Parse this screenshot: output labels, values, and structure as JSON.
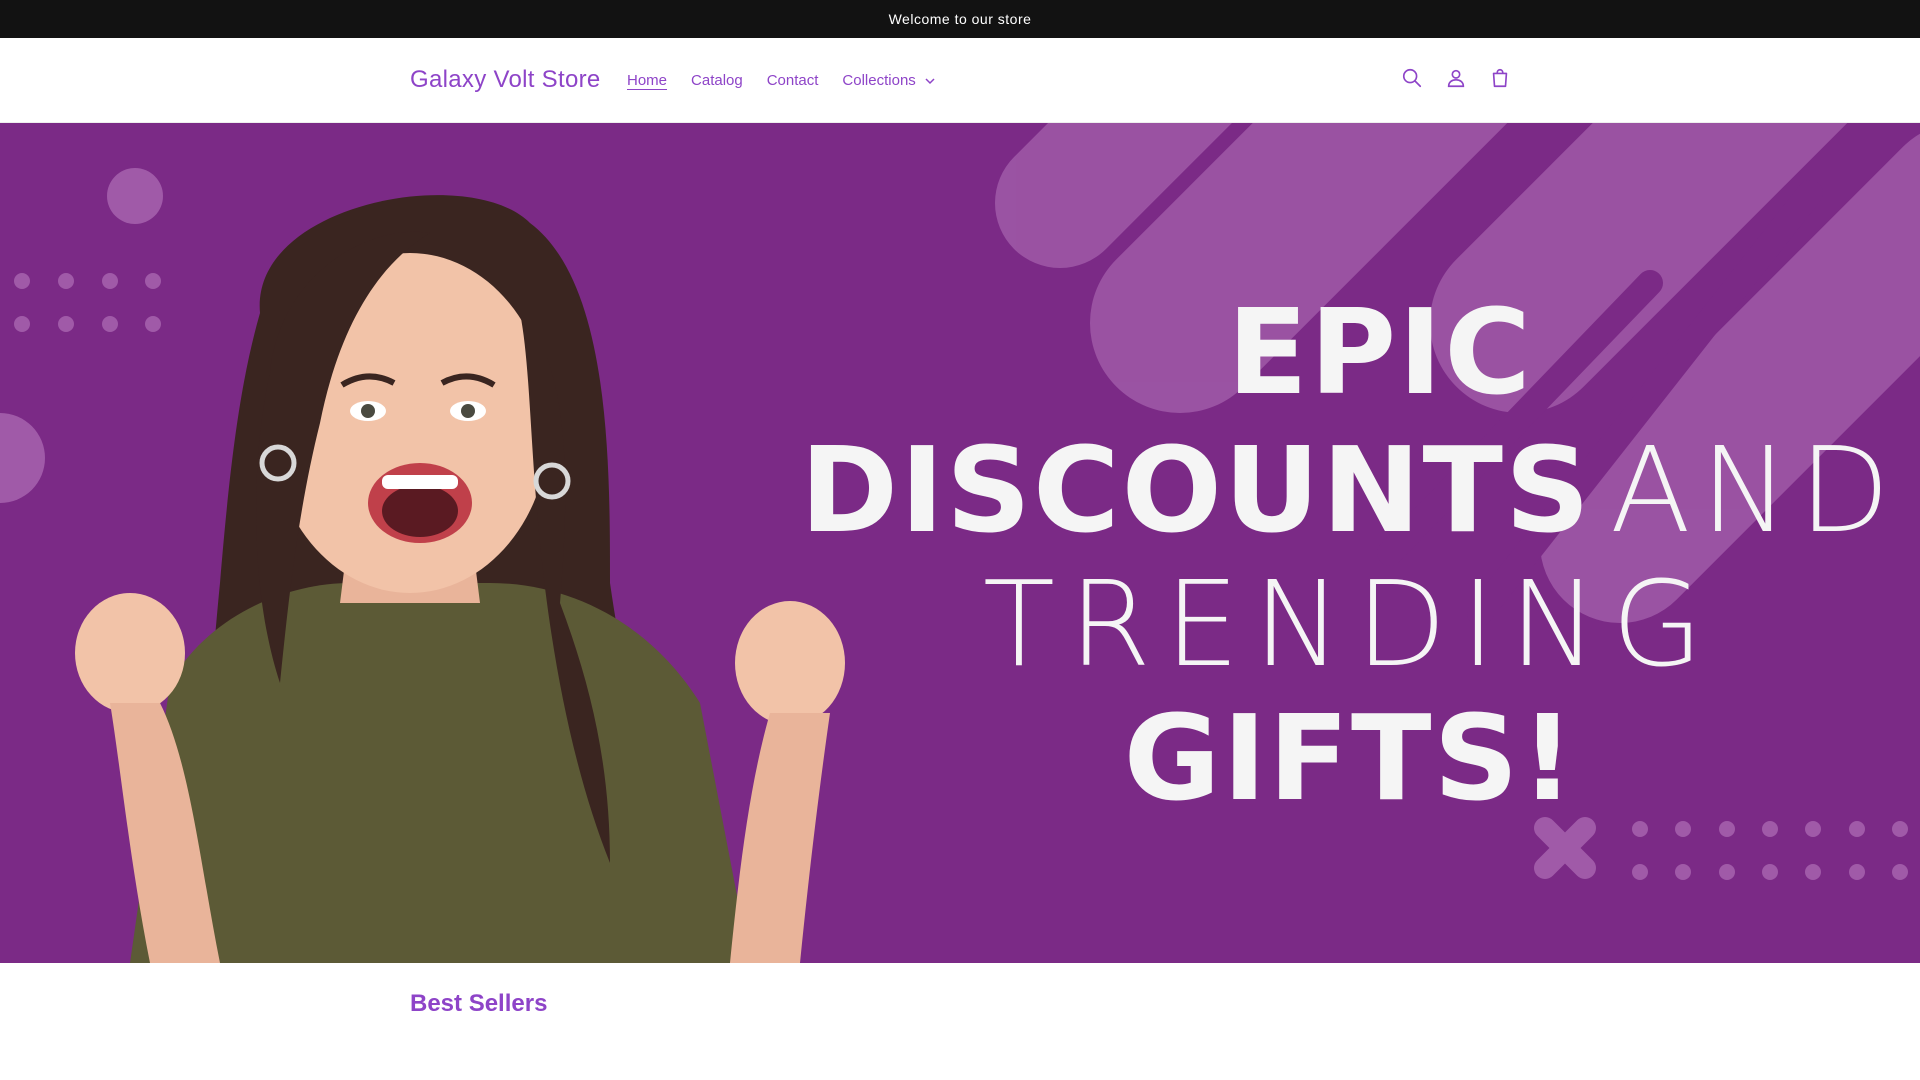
{
  "announcement": {
    "text": "Welcome to our store"
  },
  "header": {
    "brand": "Galaxy Volt Store",
    "nav": [
      {
        "label": "Home"
      },
      {
        "label": "Catalog"
      },
      {
        "label": "Contact"
      },
      {
        "label": "Collections"
      }
    ],
    "icons": [
      "search-icon",
      "account-icon",
      "cart-icon"
    ]
  },
  "hero": {
    "line1": "EPIC",
    "line2_bold": "DISCOUNTS",
    "line2_thin": "AND",
    "line3": "TRENDING",
    "line4": "GIFTS!",
    "background_color": "#7b2a86",
    "accent_color": "#8e44c8"
  },
  "best_sellers": {
    "title": "Best Sellers"
  }
}
